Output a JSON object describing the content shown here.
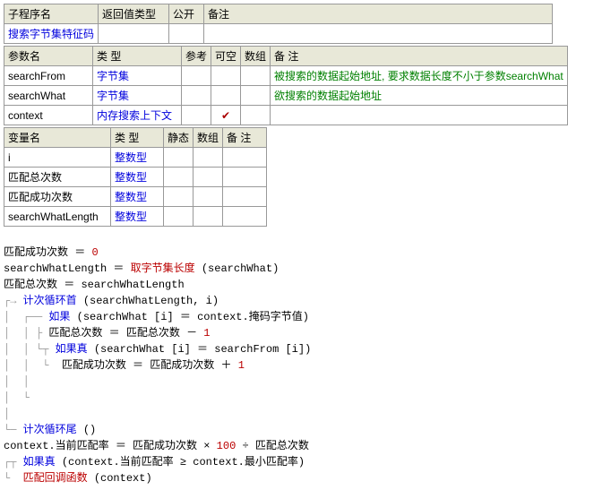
{
  "table1": {
    "headers": [
      "子程序名",
      "返回值类型",
      "公开",
      "备注"
    ],
    "row": {
      "name": "搜索字节集特征码",
      "ret": "",
      "pub": "",
      "remark": ""
    }
  },
  "table2": {
    "headers": [
      "参数名",
      "类 型",
      "参考",
      "可空",
      "数组",
      "备 注"
    ],
    "rows": [
      {
        "name": "searchFrom",
        "type": "字节集",
        "ref": "",
        "null": "",
        "arr": "",
        "remark": "被搜索的数据起始地址, 要求数据长度不小于参数searchWhat"
      },
      {
        "name": "searchWhat",
        "type": "字节集",
        "ref": "",
        "null": "",
        "arr": "",
        "remark": "欲搜索的数据起始地址"
      },
      {
        "name": "context",
        "type": "内存搜索上下文",
        "ref": "",
        "null": "✔",
        "arr": "",
        "remark": ""
      }
    ]
  },
  "table3": {
    "headers": [
      "变量名",
      "类 型",
      "静态",
      "数组",
      "备 注"
    ],
    "rows": [
      {
        "name": "i",
        "type": "整数型"
      },
      {
        "name": "匹配总次数",
        "type": "整数型"
      },
      {
        "name": "匹配成功次数",
        "type": "整数型"
      },
      {
        "name": "searchWhatLength",
        "type": "整数型"
      }
    ]
  },
  "code": {
    "l1a": "匹配成功次数",
    "l1b": "0",
    "l2a": "searchWhatLength",
    "l2b": "取字节集长度",
    "l2c": "(searchWhat)",
    "l3a": "匹配总次数",
    "l3b": "searchWhatLength",
    "l4a": "计次循环首",
    "l4b": "(searchWhatLength, i)",
    "l5a": "如果",
    "l5b": "(searchWhat [i] ",
    "l5c": "context.掩码字节值)",
    "l6a": "匹配总次数",
    "l6b": "匹配总次数",
    "l6c": "1",
    "l7a": "如果真",
    "l7b": "(searchWhat [i] ",
    "l7c": "searchFrom [i])",
    "l8a": "匹配成功次数",
    "l8b": "匹配成功次数",
    "l8c": "1",
    "l9a": "计次循环尾",
    "l9b": "()",
    "l10a": "context.当前匹配率",
    "l10b": "匹配成功次数",
    "l10c": "100",
    "l10d": "匹配总次数",
    "l11a": "如果真",
    "l11b": "(context.当前匹配率 ",
    "l11c": "context.最小匹配率)",
    "l12a": "匹配回调函数",
    "l12b": "(context)"
  }
}
